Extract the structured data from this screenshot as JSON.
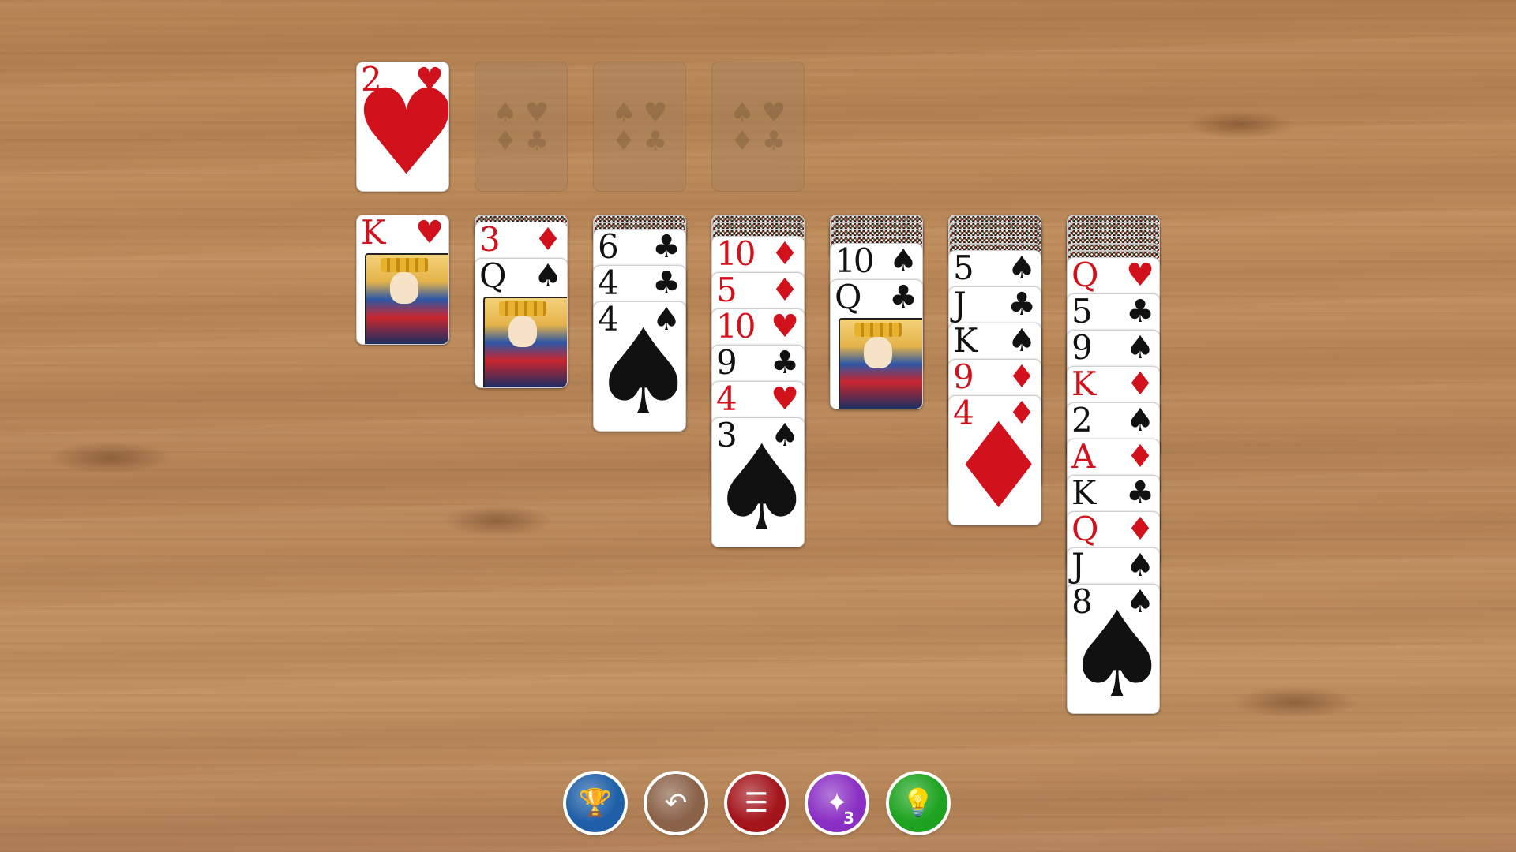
{
  "foundations": [
    {
      "rank": "2",
      "suit": "♥",
      "color": "red"
    },
    {
      "placeholder_suits": [
        "♠",
        "♥",
        "♦",
        "♣"
      ]
    },
    {
      "placeholder_suits": [
        "♠",
        "♥",
        "♦",
        "♣"
      ]
    },
    {
      "placeholder_suits": [
        "♠",
        "♥",
        "♦",
        "♣"
      ]
    }
  ],
  "tableau": [
    {
      "hidden": 0,
      "cards": [
        {
          "rank": "K",
          "suit": "♥",
          "color": "red",
          "face": "king"
        }
      ]
    },
    {
      "hidden": 1,
      "cards": [
        {
          "rank": "3",
          "suit": "♦",
          "color": "red"
        },
        {
          "rank": "Q",
          "suit": "♠",
          "color": "black",
          "face": "queen"
        }
      ]
    },
    {
      "hidden": 2,
      "cards": [
        {
          "rank": "6",
          "suit": "♣",
          "color": "black"
        },
        {
          "rank": "4",
          "suit": "♣",
          "color": "black"
        },
        {
          "rank": "4",
          "suit": "♠",
          "color": "black"
        }
      ]
    },
    {
      "hidden": 3,
      "cards": [
        {
          "rank": "10",
          "suit": "♦",
          "color": "red"
        },
        {
          "rank": "5",
          "suit": "♦",
          "color": "red"
        },
        {
          "rank": "10",
          "suit": "♥",
          "color": "red"
        },
        {
          "rank": "9",
          "suit": "♣",
          "color": "black"
        },
        {
          "rank": "4",
          "suit": "♥",
          "color": "red"
        },
        {
          "rank": "3",
          "suit": "♠",
          "color": "black"
        }
      ]
    },
    {
      "hidden": 4,
      "cards": [
        {
          "rank": "10",
          "suit": "♠",
          "color": "black"
        },
        {
          "rank": "Q",
          "suit": "♣",
          "color": "black",
          "face": "queen"
        }
      ]
    },
    {
      "hidden": 5,
      "cards": [
        {
          "rank": "5",
          "suit": "♠",
          "color": "black"
        },
        {
          "rank": "J",
          "suit": "♣",
          "color": "black"
        },
        {
          "rank": "K",
          "suit": "♠",
          "color": "black"
        },
        {
          "rank": "9",
          "suit": "♦",
          "color": "red"
        },
        {
          "rank": "4",
          "suit": "♦",
          "color": "red"
        }
      ]
    },
    {
      "hidden": 6,
      "cards": [
        {
          "rank": "Q",
          "suit": "♥",
          "color": "red"
        },
        {
          "rank": "5",
          "suit": "♣",
          "color": "black"
        },
        {
          "rank": "9",
          "suit": "♠",
          "color": "black"
        },
        {
          "rank": "K",
          "suit": "♦",
          "color": "red"
        },
        {
          "rank": "2",
          "suit": "♠",
          "color": "black"
        },
        {
          "rank": "A",
          "suit": "♦",
          "color": "red"
        },
        {
          "rank": "K",
          "suit": "♣",
          "color": "black"
        },
        {
          "rank": "Q",
          "suit": "♦",
          "color": "red"
        },
        {
          "rank": "J",
          "suit": "♠",
          "color": "black"
        },
        {
          "rank": "8",
          "suit": "♠",
          "color": "black"
        }
      ]
    }
  ],
  "toolbar": {
    "buttons": [
      {
        "name": "trophy-button",
        "icon": "trophy-icon",
        "glyph": "🏆",
        "color": "#1f5fa8"
      },
      {
        "name": "undo-button",
        "icon": "undo-icon",
        "glyph": "↶",
        "color": "#8a6248"
      },
      {
        "name": "menu-button",
        "icon": "menu-icon",
        "glyph": "☰",
        "color": "#a3151b"
      },
      {
        "name": "magic-wand-button",
        "icon": "magic-wand-icon",
        "glyph": "✦",
        "color": "#8a2fc4",
        "badge": "3"
      },
      {
        "name": "hint-button",
        "icon": "lightbulb-icon",
        "glyph": "💡",
        "color": "#1da31f"
      }
    ]
  },
  "colors": {
    "red_suit": "#d1111c",
    "black_suit": "#111111",
    "table": "#bd8b5b"
  }
}
